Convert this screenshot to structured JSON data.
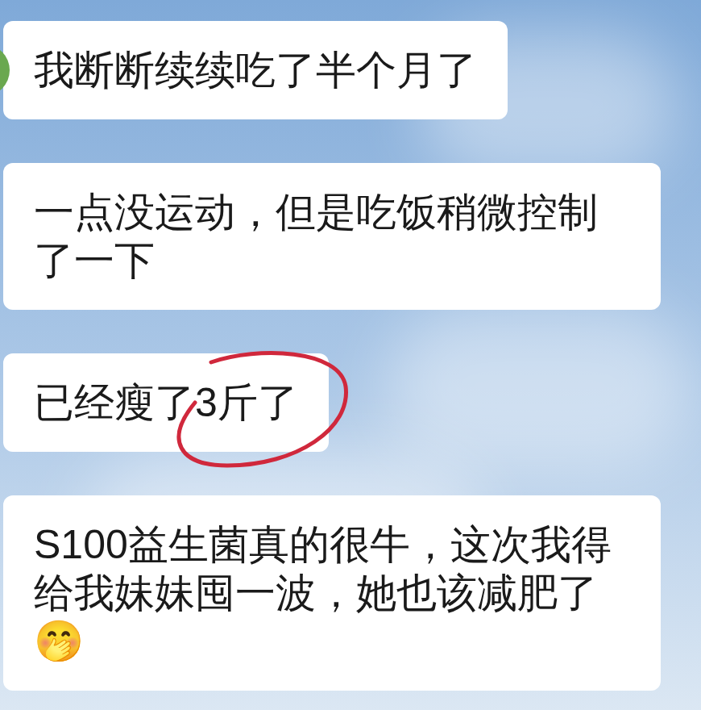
{
  "messages": [
    {
      "segments": [
        {
          "text": "我断断续续吃了半个月了",
          "circled": false
        }
      ],
      "avatar": true
    },
    {
      "segments": [
        {
          "text": "一点没运动，但是吃饭稍微控制了一下",
          "circled": false
        }
      ],
      "avatar": false
    },
    {
      "segments": [
        {
          "text": "已经瘦了",
          "circled": false
        },
        {
          "text": "3斤了",
          "circled": true
        }
      ],
      "avatar": false
    },
    {
      "segments": [
        {
          "text": "S100益生菌真的很牛，这次我得给我妹妹囤一波，她也该减肥了🤭",
          "circled": false
        }
      ],
      "avatar": false
    }
  ]
}
